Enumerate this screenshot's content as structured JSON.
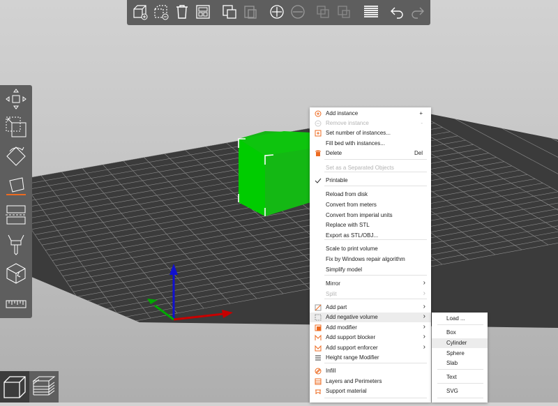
{
  "top_toolbar": {
    "buttons": [
      {
        "icon": "add-object-icon"
      },
      {
        "icon": "remove-object-icon"
      },
      {
        "icon": "delete-all-icon"
      },
      {
        "icon": "arrange-icon"
      },
      {
        "icon": "copy-icon"
      },
      {
        "icon": "paste-icon"
      },
      {
        "icon": "add-instance-icon"
      },
      {
        "icon": "remove-instance-icon"
      },
      {
        "icon": "split-objects-icon"
      },
      {
        "icon": "split-parts-icon"
      },
      {
        "icon": "layers-editing-icon"
      },
      {
        "icon": "undo-icon"
      },
      {
        "icon": "redo-icon"
      }
    ]
  },
  "left_toolbar": {
    "tools": [
      "move-icon",
      "scale-icon",
      "rotate-icon",
      "place-on-face-icon",
      "cut-icon",
      "paint-supports-icon",
      "seam-painting-icon",
      "measure-icon"
    ]
  },
  "bottom_views": [
    "3d-view-icon",
    "preview-layers-icon"
  ],
  "colors": {
    "accent": "#ed6b21",
    "object": "#00c800",
    "bed": "#3a3a3a",
    "axis_x": "#d00000",
    "axis_y": "#00b000",
    "axis_z": "#0000d0"
  },
  "context_menu": {
    "items": [
      {
        "label": "Add instance",
        "shortcut": "+",
        "icon": "add-circle-icon"
      },
      {
        "label": "Remove instance",
        "shortcut": "-",
        "icon": "remove-circle-icon",
        "disabled": true
      },
      {
        "label": "Set number of instances...",
        "icon": "instances-icon"
      },
      {
        "label": "Fill bed with instances..."
      },
      {
        "label": "Delete",
        "shortcut": "Del",
        "icon": "trash-icon"
      },
      {
        "label": "Set as a Separated Objects",
        "disabled": true
      },
      {
        "label": "Printable",
        "icon": "check-icon"
      },
      {
        "label": "Reload from disk"
      },
      {
        "label": "Convert from meters"
      },
      {
        "label": "Convert from imperial units"
      },
      {
        "label": "Replace with STL"
      },
      {
        "label": "Export as STL/OBJ..."
      },
      {
        "label": "Scale to print volume"
      },
      {
        "label": "Fix by Windows repair algorithm"
      },
      {
        "label": "Simplify model"
      },
      {
        "label": "Mirror",
        "submenu": true
      },
      {
        "label": "Split",
        "submenu": true,
        "disabled": true
      },
      {
        "label": "Add part",
        "submenu": true,
        "icon": "add-part-icon"
      },
      {
        "label": "Add negative volume",
        "submenu": true,
        "icon": "negative-volume-icon"
      },
      {
        "label": "Add modifier",
        "submenu": true,
        "icon": "modifier-icon"
      },
      {
        "label": "Add support blocker",
        "submenu": true,
        "icon": "support-blocker-icon"
      },
      {
        "label": "Add support enforcer",
        "submenu": true,
        "icon": "support-enforcer-icon"
      },
      {
        "label": "Height range Modifier",
        "icon": "height-range-icon"
      },
      {
        "label": "Infill",
        "icon": "infill-icon"
      },
      {
        "label": "Layers and Perimeters",
        "icon": "layers-icon"
      },
      {
        "label": "Support material",
        "icon": "support-material-icon"
      }
    ],
    "arrow": "›"
  },
  "submenu": {
    "items": [
      "Load ...",
      "Box",
      "Cylinder",
      "Sphere",
      "Slab",
      "Text",
      "SVG"
    ]
  }
}
